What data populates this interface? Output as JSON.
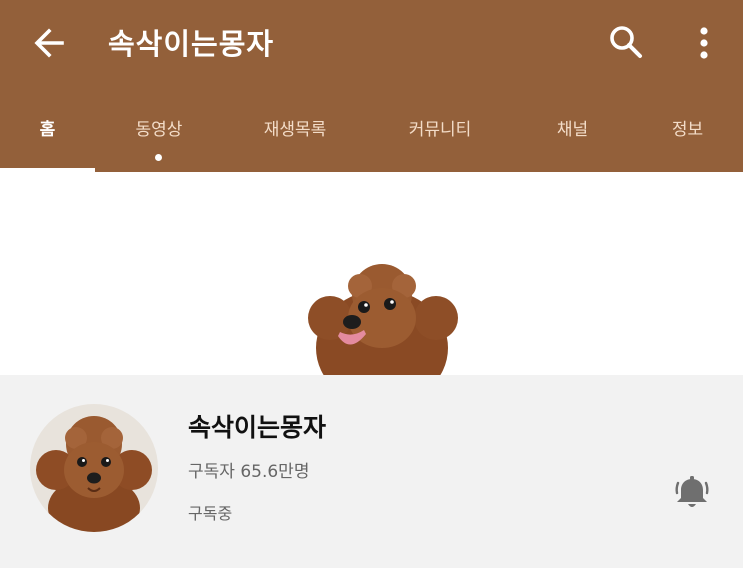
{
  "header": {
    "title": "속삭이는몽자",
    "back_icon": "arrow-left-icon",
    "search_icon": "search-icon",
    "menu_icon": "more-vert-icon",
    "background_color": "#93603a"
  },
  "tabs": [
    {
      "label": "홈",
      "active": true
    },
    {
      "label": "동영상",
      "active": false,
      "has_new_dot": true
    },
    {
      "label": "재생목록",
      "active": false
    },
    {
      "label": "커뮤니티",
      "active": false
    },
    {
      "label": "채널",
      "active": false
    },
    {
      "label": "정보",
      "active": false
    }
  ],
  "channel": {
    "name": "속삭이는몽자",
    "subscribers": "구독자 65.6만명",
    "subscription_status": "구독중",
    "bell_icon": "notification-bell-icon"
  }
}
